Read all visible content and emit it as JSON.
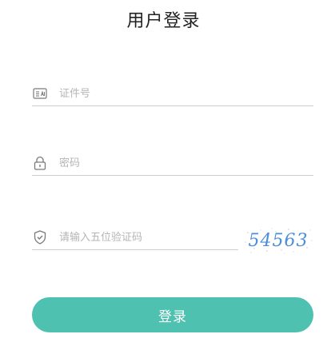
{
  "page": {
    "title": "用户登录"
  },
  "form": {
    "id_field": {
      "placeholder": "证件号",
      "value": "",
      "icon": "id-card-icon"
    },
    "password_field": {
      "placeholder": "密码",
      "value": "",
      "icon": "lock-icon"
    },
    "captcha_field": {
      "placeholder": "请输入五位验证码",
      "value": "",
      "icon": "shield-check-icon"
    },
    "captcha_image": {
      "code": "54563"
    },
    "submit_label": "登录"
  },
  "colors": {
    "accent": "#4fc1b0",
    "captcha_text": "#4a8fd8",
    "placeholder": "#b5b5b5",
    "underline": "#cfcfcf"
  }
}
